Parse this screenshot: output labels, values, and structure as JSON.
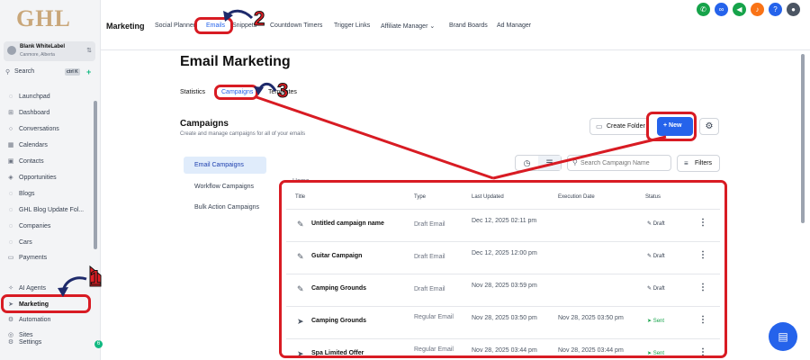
{
  "sidebar": {
    "logo": "GHL",
    "account_name": "Blank WhiteLabel",
    "account_location": "Canmore, Alberta",
    "search_label": "Search",
    "search_shortcut": "ctrl K",
    "items": [
      {
        "label": "Launchpad",
        "icon": "rocket-icon"
      },
      {
        "label": "Dashboard",
        "icon": "grid-icon"
      },
      {
        "label": "Conversations",
        "icon": "chat-icon"
      },
      {
        "label": "Calendars",
        "icon": "calendar-icon"
      },
      {
        "label": "Contacts",
        "icon": "contacts-icon"
      },
      {
        "label": "Opportunities",
        "icon": "funnel-icon"
      },
      {
        "label": "Blogs",
        "icon": "blog-icon"
      },
      {
        "label": "GHL Blog Update Fol...",
        "icon": "folder-icon"
      },
      {
        "label": "Companies",
        "icon": "building-icon"
      },
      {
        "label": "Cars",
        "icon": "car-icon"
      },
      {
        "label": "Payments",
        "icon": "card-icon"
      },
      {
        "label": "AI Agents",
        "icon": "sparkle-icon"
      },
      {
        "label": "Marketing",
        "icon": "send-icon"
      },
      {
        "label": "Automation",
        "icon": "flow-icon"
      },
      {
        "label": "Sites",
        "icon": "globe-icon"
      },
      {
        "label": "Settings",
        "icon": "gear-icon"
      }
    ],
    "notif_count": "6"
  },
  "topnav": {
    "section": "Marketing",
    "tabs": [
      "Social Planner",
      "Emails",
      "Snippets",
      "Countdown Timers",
      "Trigger Links",
      "Affiliate Manager ⌄",
      "Brand Boards",
      "Ad Manager"
    ],
    "active_tab": "Emails"
  },
  "page": {
    "title": "Email Marketing",
    "subtabs": [
      "Statistics",
      "Campaigns",
      "Templates"
    ],
    "active_subtab": "Campaigns",
    "section_title": "Campaigns",
    "section_subtitle": "Create and manage campaigns for all of your emails",
    "create_folder": "Create Folder",
    "new_button": "+ New",
    "campaign_nav": [
      "Email Campaigns",
      "Workflow Campaigns",
      "Bulk Action Campaigns"
    ],
    "search_placeholder": "Search Campaign Name",
    "filters": "Filters",
    "breadcrumb": "Home"
  },
  "table": {
    "headers": [
      "Title",
      "Type",
      "Last Updated",
      "Execution Date",
      "Status"
    ],
    "rows": [
      {
        "title": "Untitled campaign name",
        "type": "Draft Email",
        "updated": "Dec 12, 2025 02:11 pm",
        "execution": "",
        "status": "Draft",
        "icon": "edit-icon"
      },
      {
        "title": "Guitar Campaign",
        "type": "Draft Email",
        "updated": "Dec 12, 2025 12:00 pm",
        "execution": "",
        "status": "Draft",
        "icon": "edit-icon"
      },
      {
        "title": "Camping Grounds",
        "type": "Draft Email",
        "updated": "Nov 28, 2025 03:59 pm",
        "execution": "",
        "status": "Draft",
        "icon": "edit-icon"
      },
      {
        "title": "Camping Grounds",
        "type": "Regular Email",
        "updated": "Nov 28, 2025 03:50 pm",
        "execution": "Nov 28, 2025 03:50 pm",
        "status": "Sent",
        "icon": "send-icon"
      },
      {
        "title": "Spa Limited Offer",
        "type": "Regular Email",
        "updated": "Nov 28, 2025 03:44 pm",
        "execution": "Nov 28, 2025 03:44 pm",
        "status": "Sent",
        "icon": "send-icon"
      }
    ]
  },
  "annotations": {
    "step1": "1",
    "step2": "2",
    "step3": "3",
    "color": "#d81b23"
  },
  "colors": {
    "accent": "#2563eb",
    "sent": "#16a34a",
    "annotation": "#d81b23"
  }
}
